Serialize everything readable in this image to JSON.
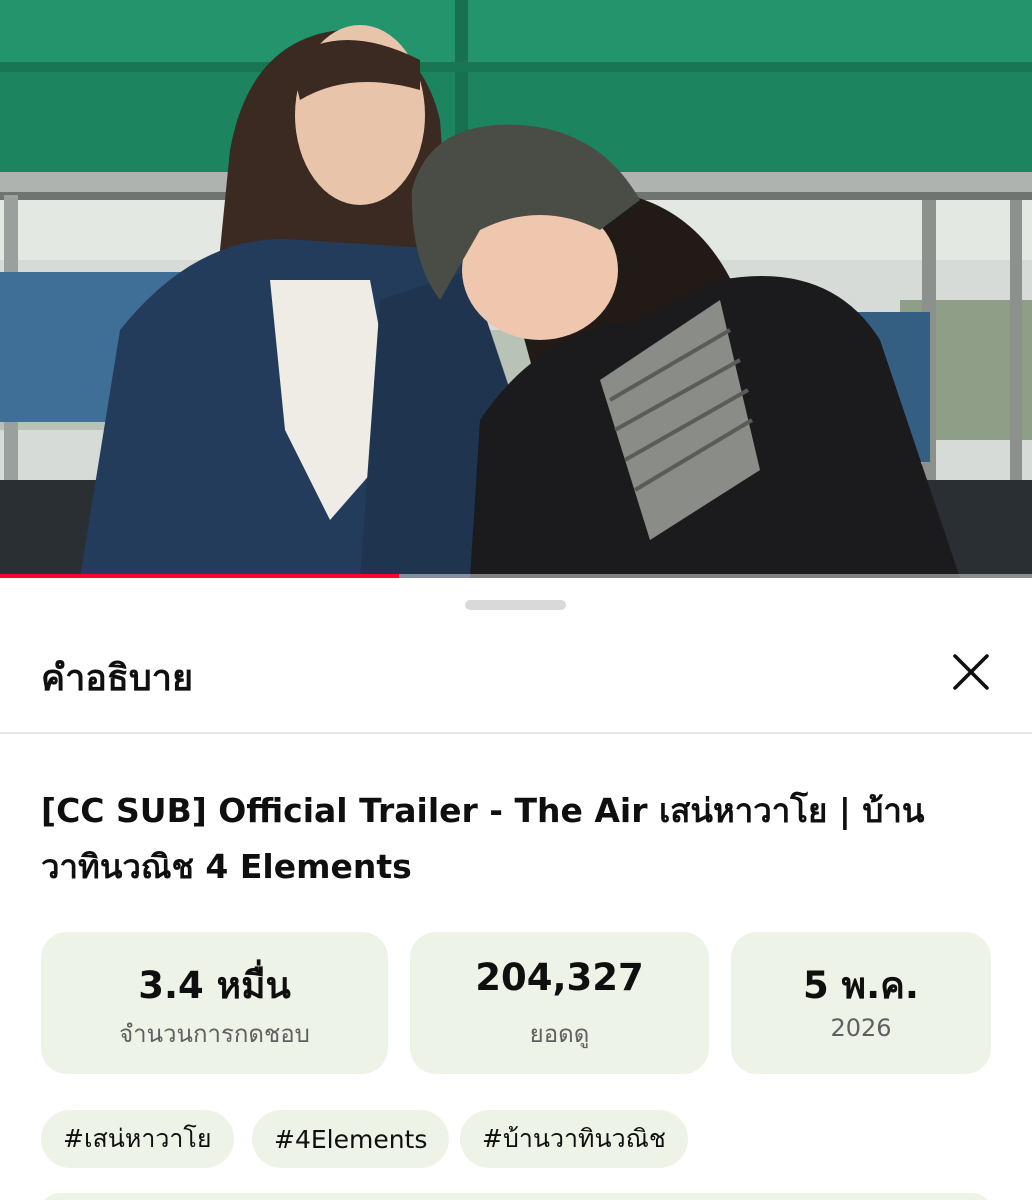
{
  "player": {
    "progress_fraction": 0.387
  },
  "description_sheet": {
    "title": "คำอธิบาย",
    "close_icon": "close-icon",
    "video_title": "[CC SUB] Official Trailer - The Air เสน่หาวาโย | บ้านวาทินวณิช 4 Elements",
    "stats": [
      {
        "value": "3.4 หมื่น",
        "label": "จำนวนการกดชอบ"
      },
      {
        "value": "204,327",
        "label": "ยอดดู"
      },
      {
        "value": "5 พ.ค.",
        "label": "2026"
      }
    ],
    "hashtags": [
      "#เสน่หาวาโย",
      "#4Elements",
      "#บ้านวาทินวณิช"
    ]
  },
  "colors": {
    "progress": "#ff0033",
    "chip_background": "#edf3e6",
    "text_primary": "#0f0f0f",
    "text_secondary": "#606060"
  }
}
